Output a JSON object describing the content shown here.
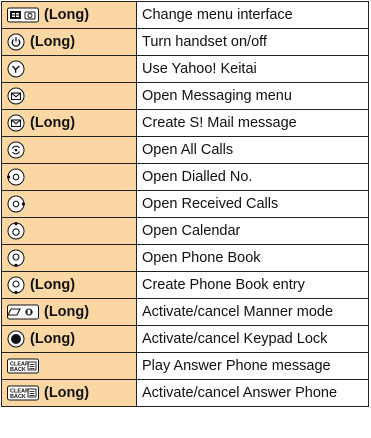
{
  "rows": [
    {
      "icon": "menu-camera-key-icon",
      "modifier": "(Long)",
      "action": "Change menu interface"
    },
    {
      "icon": "power-key-icon",
      "modifier": "(Long)",
      "action": "Turn handset on/off"
    },
    {
      "icon": "yahoo-key-icon",
      "modifier": "",
      "action": "Use Yahoo! Keitai"
    },
    {
      "icon": "mail-key-icon",
      "modifier": "",
      "action": "Open Messaging menu"
    },
    {
      "icon": "mail-key-icon",
      "modifier": "(Long)",
      "action": "Create S! Mail message"
    },
    {
      "icon": "all-calls-key-icon",
      "modifier": "",
      "action": "Open All Calls"
    },
    {
      "icon": "dialled-key-icon",
      "modifier": "",
      "action": "Open Dialled No."
    },
    {
      "icon": "received-key-icon",
      "modifier": "",
      "action": "Open Received Calls"
    },
    {
      "icon": "calendar-key-icon",
      "modifier": "",
      "action": "Open Calendar"
    },
    {
      "icon": "phonebook-key-icon",
      "modifier": "",
      "action": "Open Phone Book"
    },
    {
      "icon": "phonebook-key-icon",
      "modifier": "(Long)",
      "action": "Create Phone Book entry"
    },
    {
      "icon": "manner-key-icon",
      "modifier": "(Long)",
      "action": "Activate/cancel Manner mode"
    },
    {
      "icon": "center-key-icon",
      "modifier": "(Long)",
      "action": "Activate/cancel Keypad Lock"
    },
    {
      "icon": "clear-back-key-icon",
      "modifier": "",
      "action": "Play Answer Phone message"
    },
    {
      "icon": "clear-back-key-icon",
      "modifier": "(Long)",
      "action": "Activate/cancel Answer Phone"
    }
  ]
}
